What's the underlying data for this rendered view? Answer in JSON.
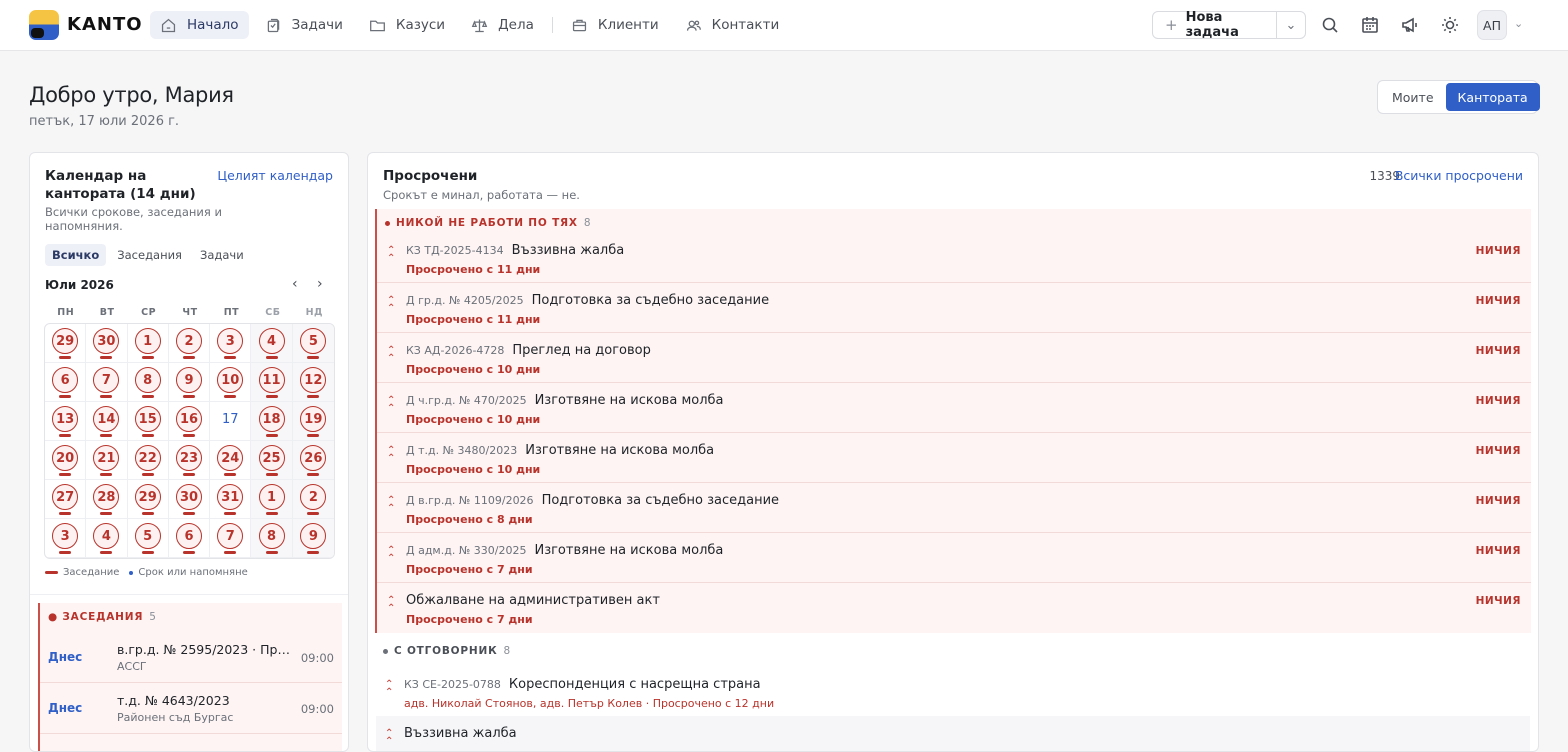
{
  "app": {
    "brand": "KANTO"
  },
  "nav": [
    {
      "label": "Начало",
      "icon": "home-icon",
      "active": true
    },
    {
      "label": "Задачи",
      "icon": "task-icon"
    },
    {
      "label": "Казуси",
      "icon": "folder-icon"
    },
    {
      "label": "Дела",
      "icon": "scales-icon"
    },
    {
      "label": "Клиенти",
      "icon": "briefcase-icon"
    },
    {
      "label": "Контакти",
      "icon": "contacts-icon"
    }
  ],
  "toolbar": {
    "new_task": "Нова задача",
    "plus": "+",
    "caret": "⌄",
    "avatar": "АП"
  },
  "header": {
    "greeting": "Добро утро, Мария",
    "date": "петък, 17 юли 2026 г."
  },
  "scope": {
    "options": [
      "Моите",
      "Кантората"
    ],
    "selected": "Кантората"
  },
  "calendar": {
    "title": "Календар на кантората (14 дни)",
    "link": "Целият календар",
    "subtitle": "Всички срокове, заседания и напомняния.",
    "tabs": [
      "Всичко",
      "Заседания",
      "Задачи"
    ],
    "active_tab": "Всичко",
    "month": "Юли 2026",
    "prev": "‹",
    "next": "›",
    "weekdays": [
      "ПН",
      "ВТ",
      "СР",
      "ЧТ",
      "ПТ",
      "СБ",
      "НД"
    ],
    "days": [
      "29",
      "30",
      "1",
      "2",
      "3",
      "4",
      "5",
      "6",
      "7",
      "8",
      "9",
      "10",
      "11",
      "12",
      "13",
      "14",
      "15",
      "16",
      "17",
      "18",
      "19",
      "20",
      "21",
      "22",
      "23",
      "24",
      "25",
      "26",
      "27",
      "28",
      "29",
      "30",
      "31",
      "1",
      "2",
      "3",
      "4",
      "5",
      "6",
      "7",
      "8",
      "9"
    ],
    "today_index": 18,
    "legend_hearing": "Заседание",
    "legend_deadline": "Срок или напомняне"
  },
  "hearings": {
    "heading": "ЗАСЕДАНИЯ",
    "count": "5",
    "items": [
      {
        "day": "Днес",
        "title": "в.гр.д. № 2595/2023 · При...",
        "court": "АССГ",
        "time": "09:00"
      },
      {
        "day": "Днес",
        "title": "т.д. № 4643/2023",
        "court": "Районен съд Бургас",
        "time": "09:00"
      },
      {
        "day": "",
        "title": "",
        "court": "",
        "time": ""
      }
    ]
  },
  "overdue": {
    "title": "Просрочени",
    "subtitle": "Срокът е минал, работата — не.",
    "count": "1339",
    "link": "Всички просрочени",
    "group1": {
      "heading": "НИКОЙ НЕ РАБОТИ ПО ТЯХ",
      "count": "8",
      "items": [
        {
          "case": "КЗ ТД-2025-4134",
          "title": "Въззивна жалба",
          "status": "Просрочено с 11 дни",
          "badge": "НИЧИЯ"
        },
        {
          "case": "Д гр.д. № 4205/2025",
          "title": "Подготовка за съдебно заседание",
          "status": "Просрочено с 11 дни",
          "badge": "НИЧИЯ"
        },
        {
          "case": "КЗ АД-2026-4728",
          "title": "Преглед на договор",
          "status": "Просрочено с 10 дни",
          "badge": "НИЧИЯ"
        },
        {
          "case": "Д ч.гр.д. № 470/2025",
          "title": "Изготвяне на искова молба",
          "status": "Просрочено с 10 дни",
          "badge": "НИЧИЯ"
        },
        {
          "case": "Д т.д. № 3480/2023",
          "title": "Изготвяне на искова молба",
          "status": "Просрочено с 10 дни",
          "badge": "НИЧИЯ"
        },
        {
          "case": "Д в.гр.д. № 1109/2026",
          "title": "Подготовка за съдебно заседание",
          "status": "Просрочено с 8 дни",
          "badge": "НИЧИЯ"
        },
        {
          "case": "Д адм.д. № 330/2025",
          "title": "Изготвяне на искова молба",
          "status": "Просрочено с 7 дни",
          "badge": "НИЧИЯ"
        },
        {
          "case": "",
          "title": "Обжалване на административен акт",
          "status": "Просрочено с 7 дни",
          "badge": "НИЧИЯ"
        }
      ]
    },
    "group2": {
      "heading": "С ОТГОВОРНИК",
      "count": "8",
      "items": [
        {
          "case": "КЗ СЕ-2025-0788",
          "title": "Кореспонденция с насрещна страна",
          "status": "адв. Николай Стоянов, адв. Петър Колев · Просрочено с 12 дни"
        },
        {
          "case": "",
          "title": "Въззивна жалба",
          "status": ""
        }
      ]
    }
  },
  "colors": {
    "accent": "#2f5fc7",
    "danger": "#b8332b",
    "danger_bg": "#fdf4f3"
  }
}
